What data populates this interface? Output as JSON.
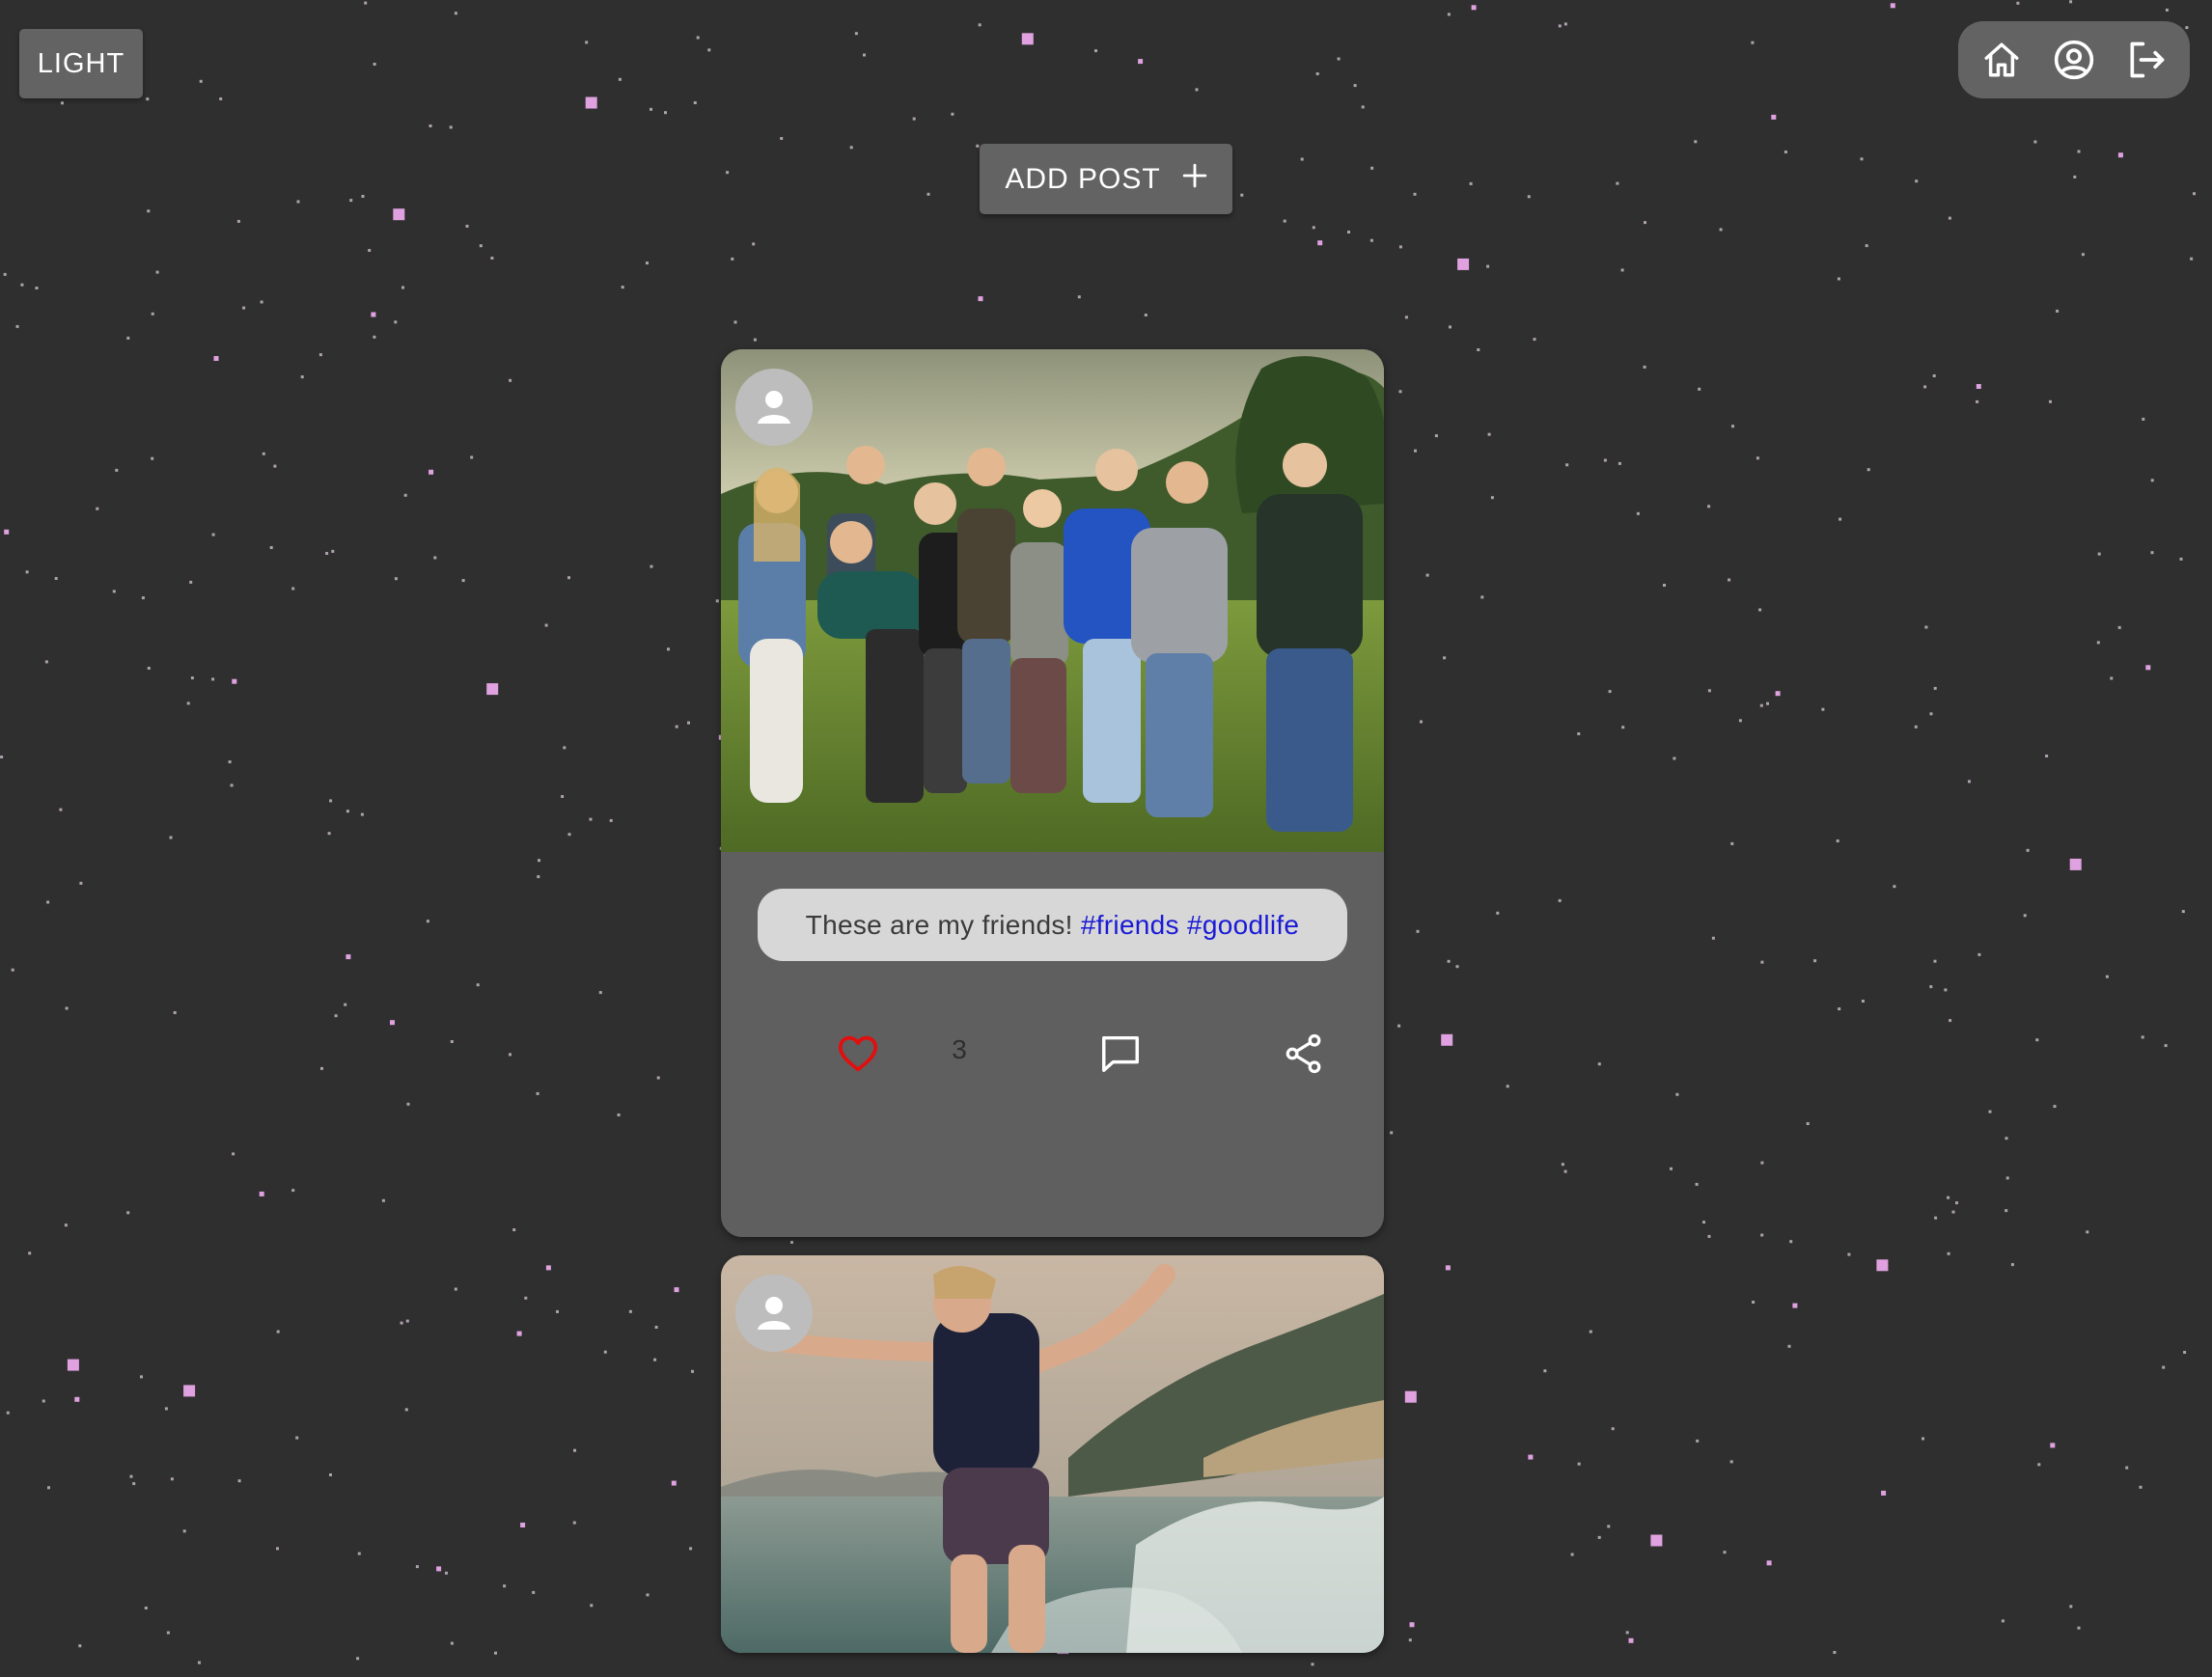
{
  "theme_toggle": {
    "label": "LIGHT"
  },
  "nav": {
    "items": [
      {
        "name": "home",
        "icon": "home-icon"
      },
      {
        "name": "profile",
        "icon": "account-circle-icon"
      },
      {
        "name": "logout",
        "icon": "logout-icon"
      }
    ]
  },
  "add_post": {
    "label": "ADD POST",
    "icon": "plus-icon"
  },
  "posts": [
    {
      "avatar_icon": "person-icon",
      "caption_text": "These are my friends!",
      "hashtags": [
        "#friends",
        "#goodlife"
      ],
      "like_count": "3",
      "liked": true,
      "icons": [
        "heart-icon",
        "comment-icon",
        "share-icon"
      ]
    },
    {
      "avatar_icon": "person-icon"
    }
  ],
  "colors": {
    "background": "#2f2f2f",
    "button": "#636363",
    "card": "#5f5f5f",
    "caption_bg": "#d7d7d7",
    "hashtag": "#1a1ad6",
    "like": "#e01010",
    "star": "#e9a8e9"
  }
}
